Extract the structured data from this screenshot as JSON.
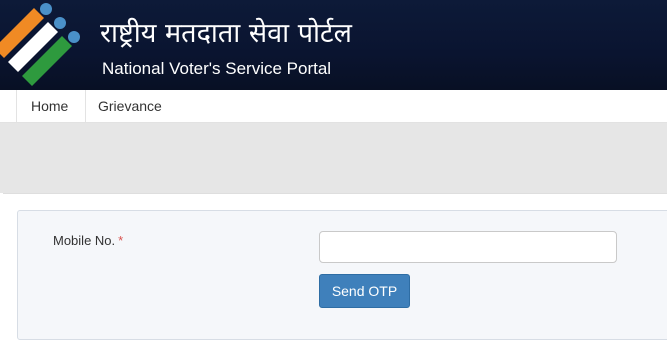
{
  "header": {
    "title_hindi": "राष्ट्रीय मतदाता सेवा पोर्टल",
    "title_english": "National Voter's Service Portal",
    "logo": "eci-tricolor-ballot-logo-icon"
  },
  "nav": {
    "items": [
      {
        "label": "Home"
      },
      {
        "label": "Grievance"
      }
    ]
  },
  "form": {
    "mobile_label": "Mobile No.",
    "required_marker": "*",
    "mobile_value": "",
    "mobile_placeholder": "",
    "send_otp_label": "Send OTP"
  },
  "colors": {
    "header_bg": "#0a1430",
    "button_bg": "#3f80bb",
    "required": "#d9534f",
    "logo_orange": "#f08a24",
    "logo_green": "#2e9a3e",
    "logo_blue": "#4a90c8"
  }
}
